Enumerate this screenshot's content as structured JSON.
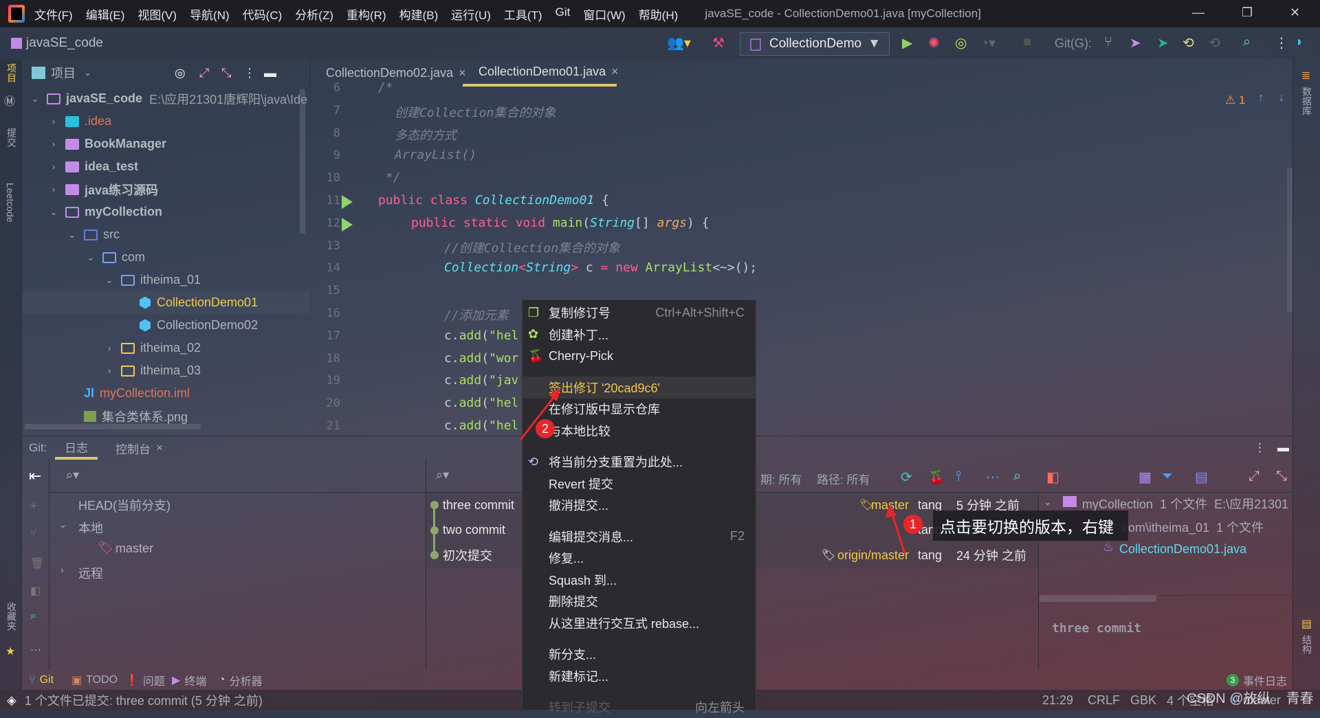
{
  "window": {
    "title": "javaSE_code - CollectionDemo01.java [myCollection]"
  },
  "menubar": [
    "文件(F)",
    "编辑(E)",
    "视图(V)",
    "导航(N)",
    "代码(C)",
    "分析(Z)",
    "重构(R)",
    "构建(B)",
    "运行(U)",
    "工具(T)",
    "Git",
    "窗口(W)",
    "帮助(H)"
  ],
  "navbar": {
    "project": "javaSE_code",
    "run_config": "CollectionDemo",
    "git_label": "Git(G):"
  },
  "left_strip": {
    "project": "项目",
    "commit": "提交",
    "leetcode": "Leetcode",
    "favorites": "收藏夹"
  },
  "right_strip": {
    "database": "数据库",
    "structure": "结构"
  },
  "project_panel": {
    "title": "项目",
    "tree": [
      {
        "label": "javaSE_code",
        "extra": "E:\\应用21301唐辉阳\\java\\Ide",
        "depth": 0,
        "chev": "down",
        "icon": "module-folder",
        "color": "#b4b9c0",
        "bold": true
      },
      {
        "label": ".idea",
        "depth": 1,
        "chev": "right",
        "icon": "idea-folder",
        "color": "#d87a5a"
      },
      {
        "label": "BookManager",
        "depth": 1,
        "chev": "right",
        "icon": "module-folder",
        "color": "#b4b9c0",
        "bold": true
      },
      {
        "label": "idea_test",
        "depth": 1,
        "chev": "right",
        "icon": "module-folder",
        "color": "#b4b9c0",
        "bold": true
      },
      {
        "label": "java练习源码",
        "depth": 1,
        "chev": "right",
        "icon": "module-folder",
        "color": "#b4b9c0",
        "bold": true
      },
      {
        "label": "myCollection",
        "depth": 1,
        "chev": "down",
        "icon": "module-folder",
        "color": "#b4b9c0",
        "bold": true
      },
      {
        "label": "src",
        "depth": 2,
        "chev": "down",
        "icon": "source-folder",
        "color": "#aeb3ba"
      },
      {
        "label": "com",
        "depth": 3,
        "chev": "down",
        "icon": "package-folder",
        "color": "#aeb3ba"
      },
      {
        "label": "itheima_01",
        "depth": 4,
        "chev": "down",
        "icon": "package-folder",
        "color": "#aeb3ba"
      },
      {
        "label": "CollectionDemo01",
        "depth": 5,
        "chev": "",
        "icon": "java-class",
        "color": "#f0c84a",
        "selected": true
      },
      {
        "label": "CollectionDemo02",
        "depth": 5,
        "chev": "",
        "icon": "java-class",
        "color": "#aeb3ba"
      },
      {
        "label": "itheima_02",
        "depth": 4,
        "chev": "right",
        "icon": "package-folder-yellow",
        "color": "#aeb3ba"
      },
      {
        "label": "itheima_03",
        "depth": 4,
        "chev": "right",
        "icon": "package-folder-yellow",
        "color": "#aeb3ba"
      },
      {
        "label": "myCollection.iml",
        "depth": 2,
        "chev": "",
        "icon": "iml-file",
        "color": "#d87a5a"
      },
      {
        "label": "集合类体系.png",
        "depth": 2,
        "chev": "",
        "icon": "image-file",
        "color": "#aeb3ba"
      }
    ]
  },
  "editor": {
    "tabs": [
      {
        "label": "CollectionDemo02.java",
        "active": false
      },
      {
        "label": "CollectionDemo01.java",
        "active": true
      }
    ],
    "warnings": "1",
    "lines": [
      {
        "n": "6",
        "indent": 0,
        "parts": [
          [
            "cm",
            "/*"
          ]
        ]
      },
      {
        "n": "7",
        "indent": 1,
        "parts": [
          [
            "cm",
            "创建Collection集合的对象"
          ]
        ]
      },
      {
        "n": "8",
        "indent": 1,
        "parts": [
          [
            "cm",
            "多态的方式"
          ]
        ]
      },
      {
        "n": "9",
        "indent": 1,
        "parts": [
          [
            "cm",
            "ArrayList()"
          ]
        ]
      },
      {
        "n": "10",
        "indent": 0,
        "parts": [
          [
            "cm",
            " */"
          ]
        ]
      },
      {
        "n": "11",
        "indent": 0,
        "run": true,
        "parts": [
          [
            "kw",
            "public class "
          ],
          [
            "cls",
            "CollectionDemo01"
          ],
          [
            "",
            " {"
          ]
        ]
      },
      {
        "n": "12",
        "indent": 2,
        "run": true,
        "parts": [
          [
            "kw",
            "public static void "
          ],
          [
            "fn",
            "main"
          ],
          [
            "",
            "("
          ],
          [
            "cls",
            "String"
          ],
          [
            "",
            "[] "
          ],
          [
            "par",
            "args"
          ],
          [
            "",
            ") {"
          ]
        ]
      },
      {
        "n": "13",
        "indent": 4,
        "parts": [
          [
            "cm",
            "//创建Collection集合的对象"
          ]
        ]
      },
      {
        "n": "14",
        "indent": 4,
        "parts": [
          [
            "cls",
            "Collection"
          ],
          [
            "kw",
            "<"
          ],
          [
            "cls",
            "String"
          ],
          [
            "kw",
            ">"
          ],
          [
            "",
            " c "
          ],
          [
            "kw",
            "= new "
          ],
          [
            "fn",
            "ArrayList"
          ],
          [
            "",
            "<~>();"
          ]
        ]
      },
      {
        "n": "15",
        "indent": 4,
        "parts": []
      },
      {
        "n": "16",
        "indent": 4,
        "parts": [
          [
            "cm",
            "//添加元素"
          ]
        ]
      },
      {
        "n": "17",
        "indent": 4,
        "parts": [
          [
            "",
            "c."
          ],
          [
            "fn",
            "add"
          ],
          [
            "",
            "("
          ],
          [
            "fn",
            "\"hel"
          ]
        ]
      },
      {
        "n": "18",
        "indent": 4,
        "parts": [
          [
            "",
            "c."
          ],
          [
            "fn",
            "add"
          ],
          [
            "",
            "("
          ],
          [
            "fn",
            "\"wor"
          ]
        ]
      },
      {
        "n": "19",
        "indent": 4,
        "parts": [
          [
            "",
            "c."
          ],
          [
            "fn",
            "add"
          ],
          [
            "",
            "("
          ],
          [
            "fn",
            "\"jav"
          ]
        ]
      },
      {
        "n": "20",
        "indent": 4,
        "parts": [
          [
            "",
            "c."
          ],
          [
            "fn",
            "add"
          ],
          [
            "",
            "("
          ],
          [
            "fn",
            "\"hel"
          ]
        ]
      },
      {
        "n": "21",
        "indent": 4,
        "parts": [
          [
            "",
            "c."
          ],
          [
            "fn",
            "add"
          ],
          [
            "",
            "("
          ],
          [
            "fn",
            "\"hel"
          ]
        ]
      }
    ]
  },
  "git_panel": {
    "label": "Git:",
    "tabs": [
      {
        "label": "日志",
        "active": true
      },
      {
        "label": "控制台",
        "closable": true
      }
    ],
    "branches": {
      "head": "HEAD(当前分支)",
      "local": "本地",
      "master": "master",
      "remote": "远程"
    },
    "filters": {
      "date": "期: 所有",
      "path": "路径: 所有"
    },
    "commits": [
      {
        "message": "three commit",
        "ref": "master",
        "ref_color": "#f0c84a",
        "author": "tang",
        "time": "5 分钟 之前"
      },
      {
        "message": "two commit",
        "ref": "",
        "author": "tang",
        "time": ""
      },
      {
        "message": "初次提交",
        "ref": "origin/master",
        "ref_color": "#f0c84a",
        "author": "tang",
        "time": "24 分钟 之前"
      }
    ],
    "changes": {
      "root": "myCollection",
      "root_count": "1 个文件",
      "root_path": "E:\\应用21301",
      "pkg": "com\\itheima_01",
      "pkg_count": "1 个文件",
      "file": "CollectionDemo01.java",
      "detail_message": "three commit"
    }
  },
  "context_menu": {
    "items": [
      {
        "label": "复制修订号",
        "shortcut": "Ctrl+Alt+Shift+C",
        "icon": "copy-icon"
      },
      {
        "label": "创建补丁...",
        "icon": "patch-icon"
      },
      {
        "label": "Cherry-Pick",
        "icon": "cherry-icon"
      },
      {
        "sep": true
      },
      {
        "label": "签出修订 '20cad9c6'",
        "highlight": true
      },
      {
        "label": "在修订版中显示仓库"
      },
      {
        "label": "与本地比较"
      },
      {
        "sep": true
      },
      {
        "label": "将当前分支重置为此处...",
        "icon": "reset-icon"
      },
      {
        "label": "Revert 提交"
      },
      {
        "label": "撤消提交..."
      },
      {
        "sep": true
      },
      {
        "label": "编辑提交消息...",
        "shortcut": "F2"
      },
      {
        "label": "修复..."
      },
      {
        "label": "Squash 到..."
      },
      {
        "label": "删除提交"
      },
      {
        "label": "从这里进行交互式 rebase..."
      },
      {
        "sep": true
      },
      {
        "label": "新分支..."
      },
      {
        "label": "新建标记..."
      },
      {
        "sep": true
      },
      {
        "label": "转到子提交",
        "shortcut": "向左箭头",
        "disabled": true
      }
    ]
  },
  "annotations": {
    "step1_badge": "1",
    "step1_text": "点击要切换的版本，右键",
    "step2_badge": "2",
    "accent": "#e8262a"
  },
  "tool_windows": [
    {
      "label": "Git",
      "active": true
    },
    {
      "label": "TODO"
    },
    {
      "label": "问题"
    },
    {
      "label": "终端"
    },
    {
      "label": "分析器"
    }
  ],
  "event_log": {
    "count": "3",
    "label": "事件日志"
  },
  "status_bar": {
    "message": "1 个文件已提交: three commit (5 分钟 之前)",
    "position": "21:29",
    "line_sep": "CRLF",
    "encoding": "GBK",
    "indent": "4 个空格",
    "branch": "master",
    "watermark": "CSDN @放纵    青春"
  }
}
